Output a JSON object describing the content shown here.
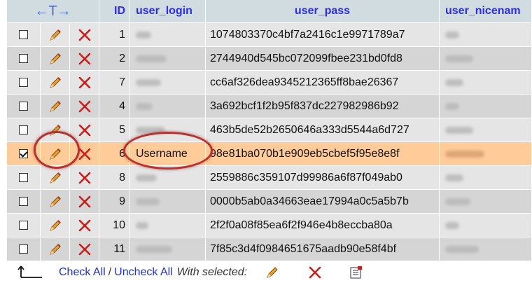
{
  "columns": {
    "arrows": "←T→",
    "id": "ID",
    "login": "user_login",
    "pass": "user_pass",
    "nicename": "user_nicenam"
  },
  "rows": [
    {
      "id": "1",
      "login": "",
      "pass": "1074803370c4bf7a2416c1e9971789a7",
      "checked": false
    },
    {
      "id": "2",
      "login": "",
      "pass": "2744940d545bc072099fbee231bd0fd8",
      "checked": false
    },
    {
      "id": "7",
      "login": "",
      "pass": "cc6af326dea9345212365ff8bae26367",
      "checked": false
    },
    {
      "id": "4",
      "login": "",
      "pass": "3a692bcf1f2b95f837dc227982986b92",
      "checked": false
    },
    {
      "id": "5",
      "login": "",
      "pass": "463b5de52b2650646a333d5544a6d727",
      "checked": false
    },
    {
      "id": "6",
      "login": "Username",
      "pass": "98e81ba070b1e909eb5cbef5f95e8e8f",
      "checked": true
    },
    {
      "id": "8",
      "login": "",
      "pass": "2559886c359107d99986a6f87f049ab0",
      "checked": false
    },
    {
      "id": "9",
      "login": "",
      "pass": "0000b5ab0a34663eae17994a0c5a5b7b",
      "checked": false
    },
    {
      "id": "10",
      "login": "",
      "pass": "2f2f0a08f85ea6f2f946e4b8eccba80a",
      "checked": false
    },
    {
      "id": "11",
      "login": "",
      "pass": "7f85c3d4f0984651675aadb90e58f4bf",
      "checked": false
    }
  ],
  "footer": {
    "check_all": "Check All",
    "separator": "/",
    "uncheck_all": "Uncheck All",
    "with_selected": "With selected:"
  },
  "colors": {
    "header_bg": "#d0dce0",
    "header_text": "#2d2df0",
    "row_even": "#e5e5e5",
    "row_odd": "#d5d5d5",
    "marked_row": "#ffcc99",
    "highlight_circle": "#b8332f",
    "link": "#1f2fd0"
  }
}
